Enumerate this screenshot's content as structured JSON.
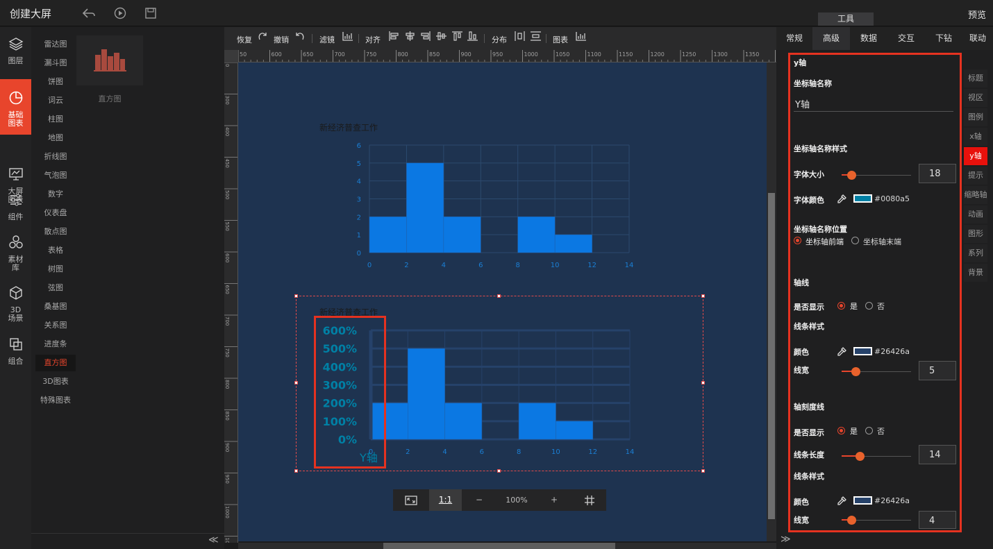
{
  "app": {
    "title": "创建大屏",
    "preview": "预览",
    "tools_tab": "工具"
  },
  "topbar_icons": [
    "back-icon",
    "play-icon",
    "save-icon"
  ],
  "rail": [
    {
      "label": "图层",
      "icon": "layers-icon"
    },
    {
      "label": "基础\n图表",
      "icon": "chart-pie-icon",
      "active": true
    },
    {
      "label": "大屏\n图表",
      "icon": "monitor-icon"
    },
    {
      "label": "组件",
      "icon": "sliders-icon"
    },
    {
      "label": "素材\n库",
      "icon": "hexagons-icon"
    },
    {
      "label": "3D\n场景",
      "icon": "cube-icon"
    },
    {
      "label": "组合",
      "icon": "group-icon"
    }
  ],
  "categories": [
    "雷达图",
    "漏斗图",
    "饼图",
    "词云",
    "柱图",
    "地图",
    "折线图",
    "气泡图",
    "数字",
    "仪表盘",
    "散点图",
    "表格",
    "树图",
    "弦图",
    "桑基图",
    "关系图",
    "进度条",
    "直方图",
    "3D图表",
    "特殊图表"
  ],
  "active_category": "直方图",
  "thumb_label": "直方图",
  "toolbar": {
    "redo": "恢复",
    "undo": "撤销",
    "filter": "滤镜",
    "align": "对齐",
    "distribute": "分布",
    "chart": "图表"
  },
  "hruler_labels": [
    "50",
    "600",
    "650",
    "700",
    "750",
    "800",
    "850",
    "900",
    "950",
    "1000",
    "1050",
    "1100",
    "1150",
    "1200",
    "1250",
    "1300",
    "1350",
    "140"
  ],
  "vruler_labels": [
    "0",
    "300",
    "400",
    "450",
    "500",
    "550",
    "600",
    "650",
    "700",
    "750",
    "800",
    "850",
    "900",
    "950",
    "1000",
    "1050"
  ],
  "chart_data": [
    {
      "type": "bar",
      "title": "新经济普查工作",
      "x_ticks": [
        0,
        2,
        4,
        6,
        8,
        10,
        12,
        14
      ],
      "y_ticks": [
        0,
        1,
        2,
        3,
        4,
        5,
        6
      ],
      "bins": [
        {
          "x0": 0,
          "x1": 2,
          "y": 2
        },
        {
          "x0": 2,
          "x1": 4,
          "y": 5
        },
        {
          "x0": 4,
          "x1": 6,
          "y": 2
        },
        {
          "x0": 8,
          "x1": 10,
          "y": 2
        },
        {
          "x0": 10,
          "x1": 12,
          "y": 1
        }
      ],
      "xlim": [
        0,
        14
      ],
      "ylim": [
        0,
        6
      ],
      "color": "#0b78e3",
      "grid": true
    },
    {
      "type": "bar",
      "title": "新经济普查工作",
      "x_ticks": [
        0,
        2,
        4,
        6,
        8,
        10,
        12,
        14
      ],
      "y_ticks": [
        "0%",
        "100%",
        "200%",
        "300%",
        "400%",
        "500%",
        "600%"
      ],
      "ylabel": "Y轴",
      "bins": [
        {
          "x0": 0,
          "x1": 2,
          "y": 2
        },
        {
          "x0": 2,
          "x1": 4,
          "y": 5
        },
        {
          "x0": 4,
          "x1": 6,
          "y": 2
        },
        {
          "x0": 8,
          "x1": 10,
          "y": 2
        },
        {
          "x0": 10,
          "x1": 12,
          "y": 1
        }
      ],
      "xlim": [
        0,
        14
      ],
      "ylim": [
        0,
        6
      ],
      "color": "#0b78e3",
      "axis_color": "#26426a",
      "grid": true
    }
  ],
  "zoom": {
    "fit": "fit-screen-icon",
    "one_to_one": "1:1",
    "minus": "−",
    "value": "100%",
    "plus": "+",
    "grid": "grid-icon"
  },
  "rtabs": [
    "常规",
    "高级",
    "数据",
    "交互",
    "下钻",
    "联动"
  ],
  "rtab_active": "高级",
  "side_tabs": [
    "标题",
    "视区",
    "图例",
    "x轴",
    "y轴",
    "提示",
    "缩略轴",
    "动画",
    "图形",
    "系列",
    "背景"
  ],
  "side_tab_active": "y轴",
  "panel": {
    "section_title": "y轴",
    "axis_name_label": "坐标轴名称",
    "axis_name_value": "Y轴",
    "name_style_label": "坐标轴名称样式",
    "font_size_label": "字体大小",
    "font_size_value": "18",
    "font_color_label": "字体颜色",
    "font_color_value": "#0080a5",
    "name_pos_label": "坐标轴名称位置",
    "name_pos_start": "坐标轴前端",
    "name_pos_end": "坐标轴末端",
    "axis_line_label": "轴线",
    "show_label": "是否显示",
    "yes": "是",
    "no": "否",
    "line_style_label": "线条样式",
    "color_label": "颜色",
    "axis_line_color": "#26426a",
    "line_width_label": "线宽",
    "axis_line_width": "5",
    "tick_label": "轴刻度线",
    "tick_show_label": "是否显示",
    "tick_yes": "是",
    "tick_no": "否",
    "tick_length_label": "线条长度",
    "tick_length_value": "14",
    "tick_style_label": "线条样式",
    "tick_color_label": "颜色",
    "tick_color": "#26426a",
    "tick_width_label": "线宽",
    "tick_width_value": "4"
  }
}
